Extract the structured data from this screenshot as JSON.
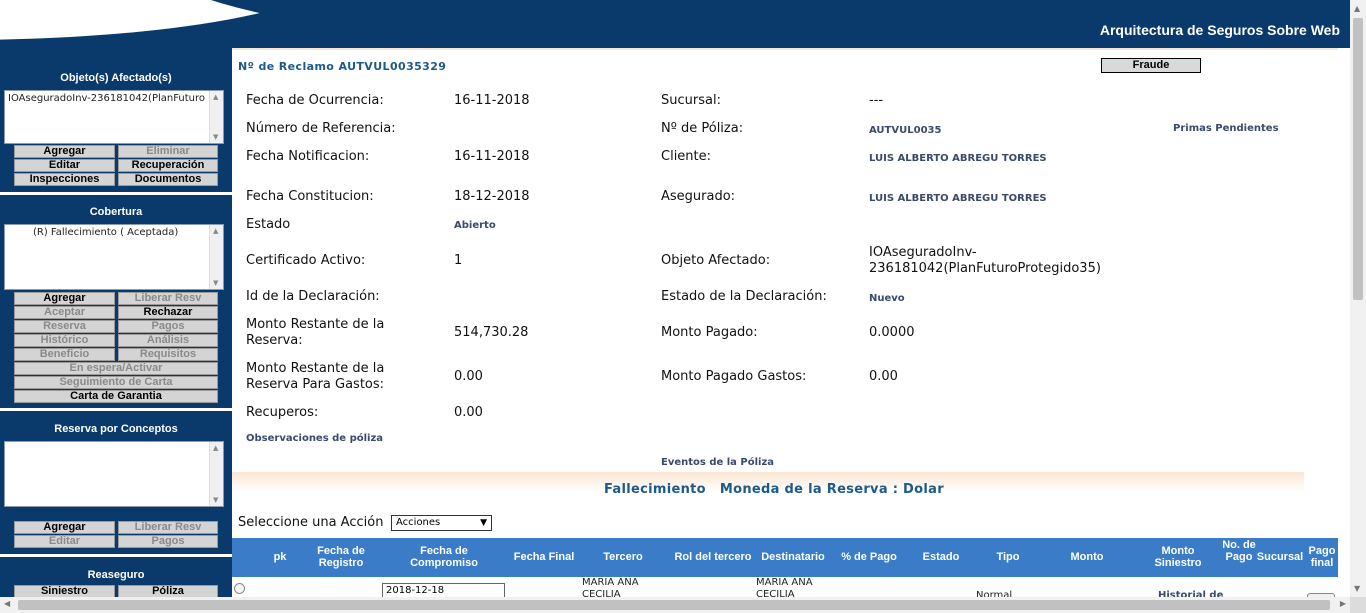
{
  "header": {
    "title": "Arquitectura de Seguros Sobre Web"
  },
  "sidebar": {
    "objetos": {
      "title": "Objeto(s) Afectado(s)",
      "items": [
        "IOAseguradoInv-236181042(PlanFuturo"
      ],
      "buttons": [
        "Agregar",
        "Eliminar",
        "Editar",
        "Recuperación",
        "Inspecciones",
        "Documentos"
      ]
    },
    "cobertura": {
      "title": "Cobertura",
      "items": [
        "(R) Fallecimiento ( Aceptada)"
      ],
      "buttons": [
        "Agregar",
        "Liberar Resv",
        "Aceptar",
        "Rechazar",
        "Reserva",
        "Pagos",
        "Histórico",
        "Análisis",
        "Beneficio",
        "Requisitos",
        "En espera/Activar",
        "Seguimiento de Carta",
        "Carta de Garantia"
      ]
    },
    "reserva": {
      "title": "Reserva por Conceptos",
      "buttons": [
        "Agregar",
        "Liberar Resv",
        "Editar",
        "Pagos"
      ]
    },
    "reaseguro": {
      "title": "Reaseguro",
      "buttons": [
        "Siniestro",
        "Póliza"
      ]
    }
  },
  "main": {
    "claim_number": "Nº de Reclamo AUTVUL0035329",
    "fraude_label": "Fraude",
    "fields": {
      "fecha_ocurrencia": {
        "label": "Fecha de Ocurrencia:",
        "value": "16-11-2018"
      },
      "numero_referencia": {
        "label": "Número de Referencia:",
        "value": ""
      },
      "fecha_notificacion": {
        "label": "Fecha Notificacion:",
        "value": "16-11-2018"
      },
      "fecha_constitucion": {
        "label": "Fecha Constitucion:",
        "value": "18-12-2018"
      },
      "estado": {
        "label": "Estado",
        "value": "Abierto"
      },
      "certificado_activo": {
        "label": "Certificado Activo:",
        "value": "1"
      },
      "id_declaracion": {
        "label": "Id de la Declaración:",
        "value": ""
      },
      "monto_restante_reserva": {
        "label": "Monto Restante de la Reserva:",
        "value": "514,730.28"
      },
      "monto_restante_gastos": {
        "label": "Monto Restante de la Reserva Para Gastos:",
        "value": "0.00"
      },
      "recuperos": {
        "label": "Recuperos:",
        "value": "0.00"
      },
      "sucursal": {
        "label": "Sucursal:",
        "value": "---"
      },
      "no_poliza": {
        "label": "Nº de Póliza:",
        "value": "AUTVUL0035"
      },
      "primas_pendientes": "Primas Pendientes",
      "cliente": {
        "label": "Cliente:",
        "value": "LUIS ALBERTO ABREGU TORRES"
      },
      "asegurado": {
        "label": "Asegurado:",
        "value": "LUIS ALBERTO ABREGU TORRES"
      },
      "objeto_afectado": {
        "label": "Objeto Afectado:",
        "value_line1": "IOAseguradoInv-",
        "value_line2": "236181042(PlanFuturoProtegido35)"
      },
      "estado_declaracion": {
        "label": "Estado de la Declaración:",
        "value": "Nuevo"
      },
      "monto_pagado": {
        "label": "Monto Pagado:",
        "value": "0.0000"
      },
      "monto_pagado_gastos": {
        "label": "Monto Pagado Gastos:",
        "value": "0.00"
      }
    },
    "observaciones_link": "Observaciones de póliza",
    "eventos_link": "Eventos de la Póliza",
    "section_title": {
      "cobertura": "Fallecimiento",
      "moneda": "Moneda de la Reserva : Dolar"
    },
    "accion": {
      "label": "Seleccione una Acción",
      "selected": "Acciones"
    },
    "table": {
      "headers": [
        "pk",
        "Fecha de Registro",
        "Fecha de Compromiso",
        "Fecha Final",
        "Tercero",
        "Rol del tercero",
        "Destinatario",
        "% de Pago",
        "Estado",
        "Tipo",
        "Monto",
        "Monto Siniestro",
        "No. de Pago",
        "Sucursal",
        "Pago final"
      ],
      "row": {
        "fecha_compromiso": "2018-12-18",
        "tercero": "MARIA ANA CECILIA",
        "destinatario": "MARIA ANA CECILIA",
        "tipo": "Normal",
        "monto_siniestro": "Historial de"
      }
    }
  }
}
